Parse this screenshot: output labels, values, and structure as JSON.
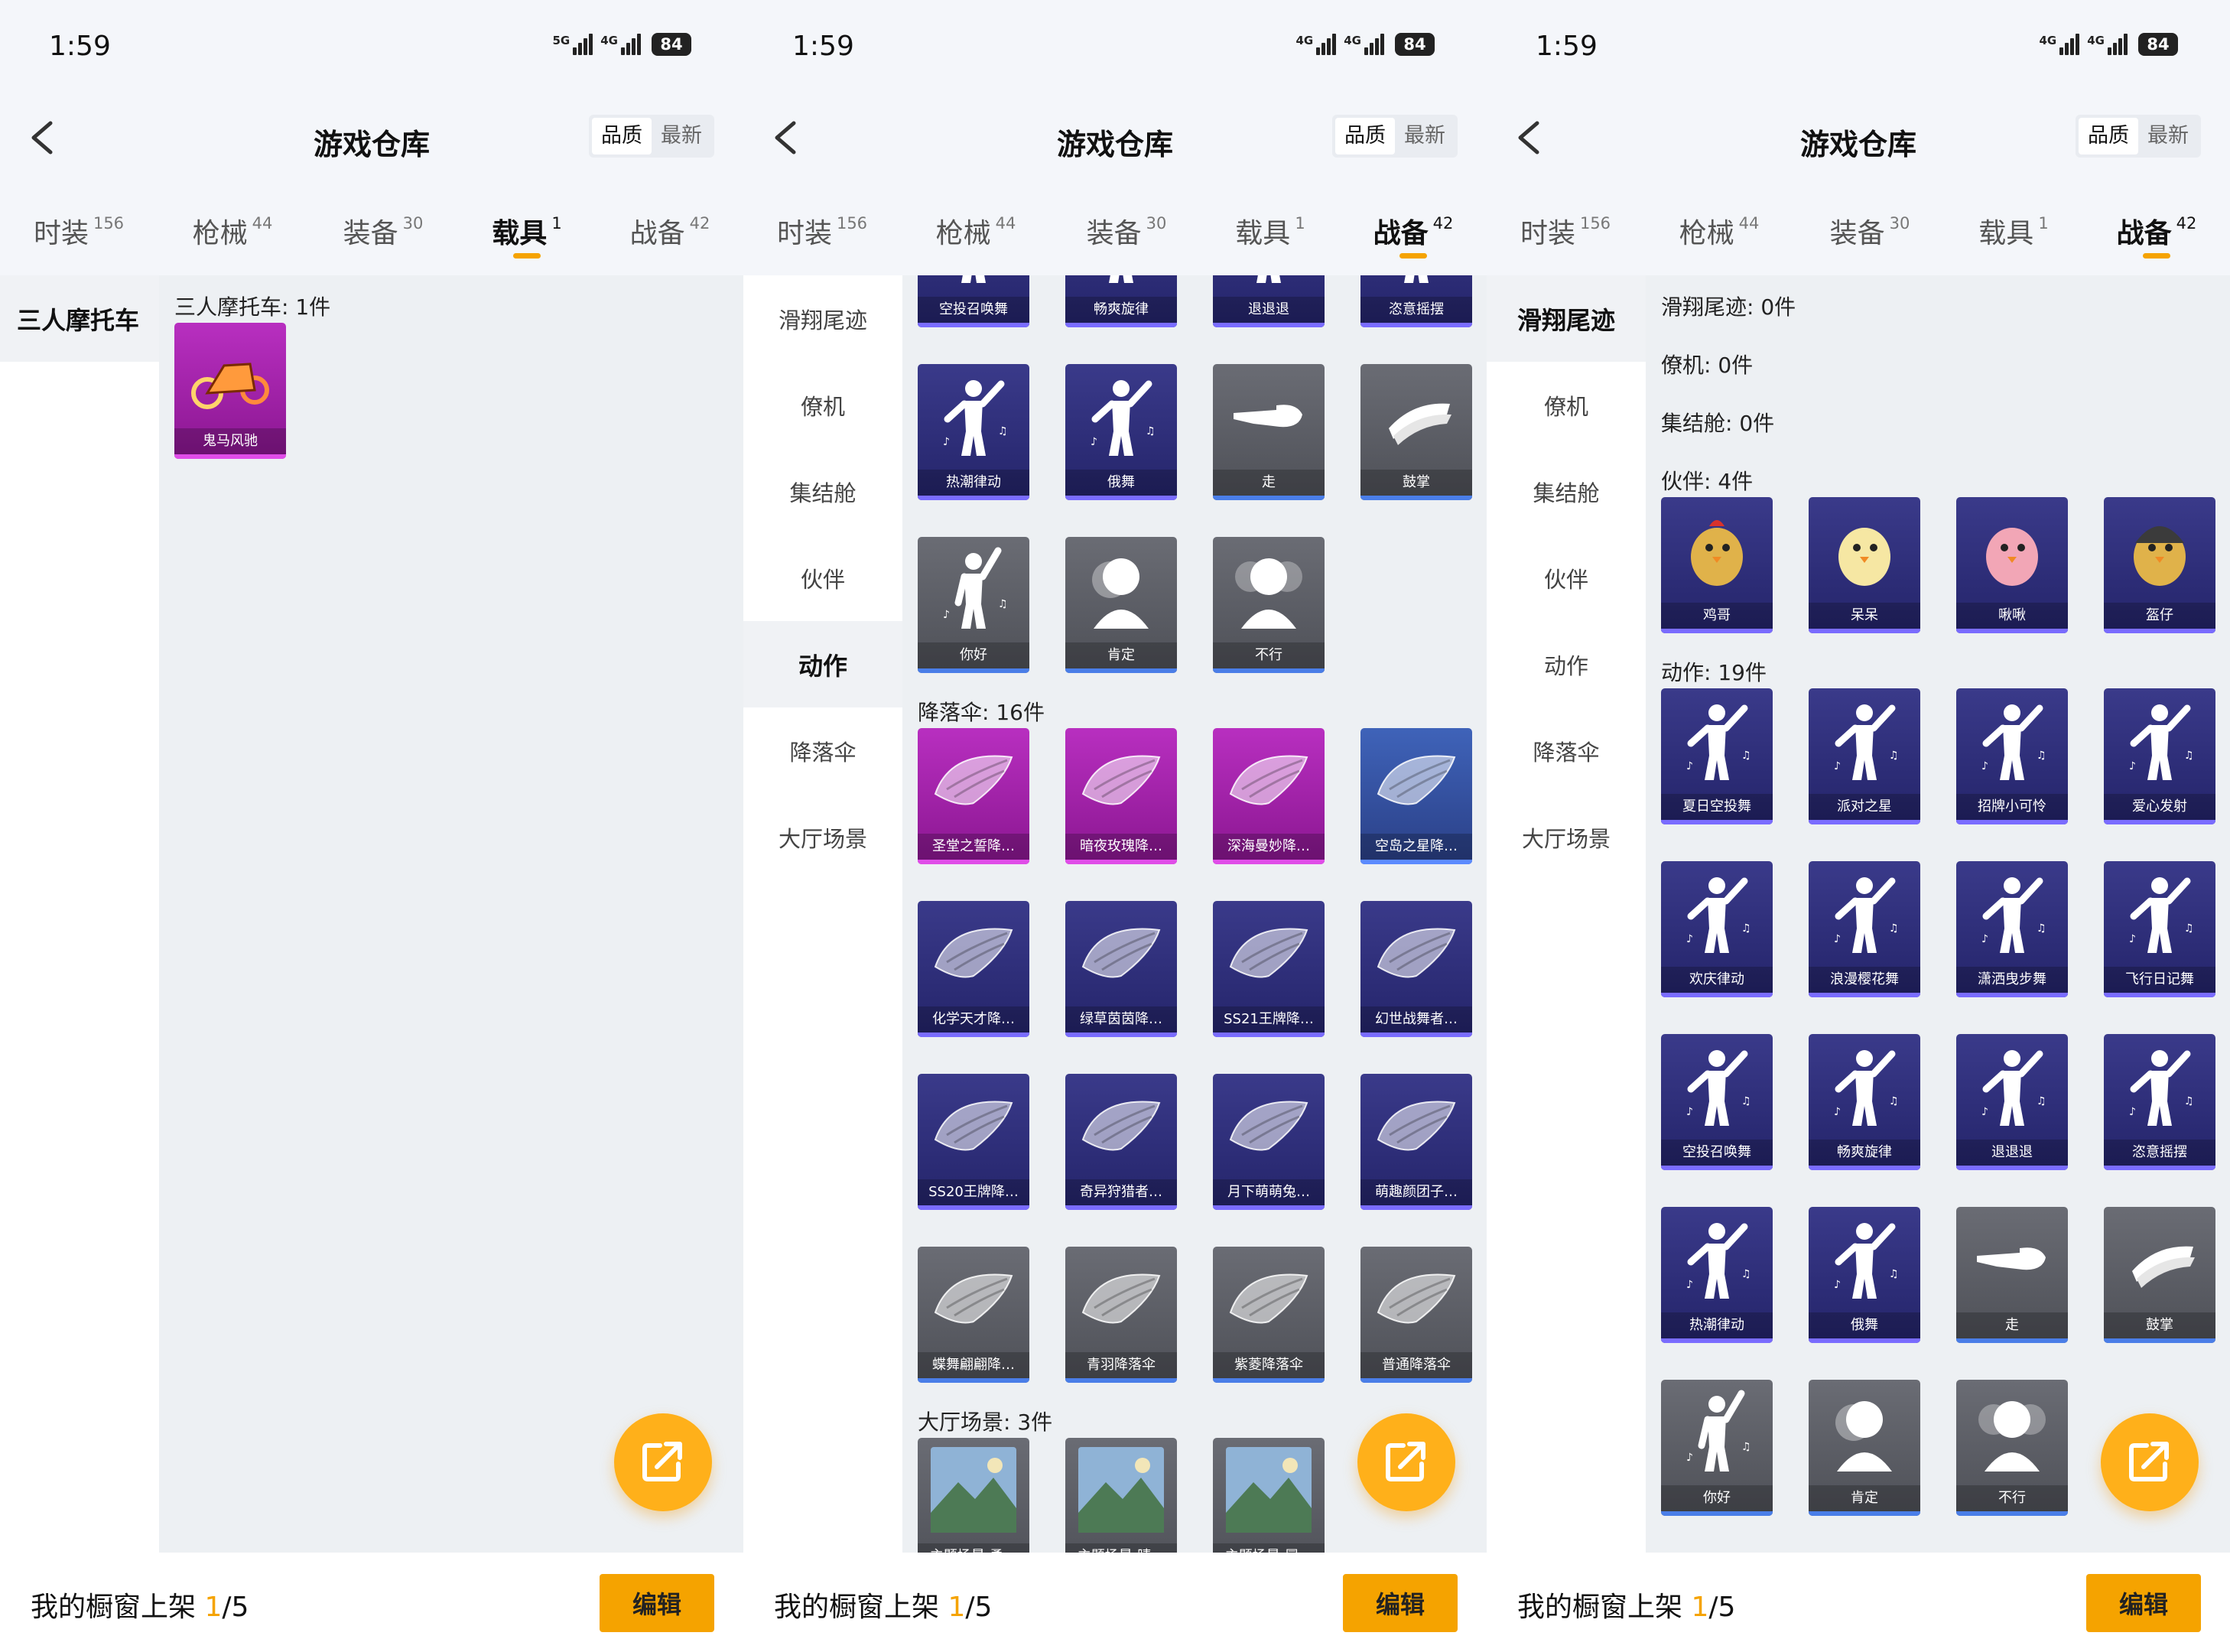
{
  "colors": {
    "accent": "#f5a300",
    "legend": "#b82fc0",
    "epic": "#3a3a8a",
    "common": "#5a5c63",
    "blue": "#3f63b9"
  },
  "panels": [
    {
      "status": {
        "time": "1:59",
        "signal_a": "5G",
        "signal_b": "4G",
        "battery": "84"
      },
      "header": {
        "title": "游戏仓库",
        "sort_quality": "品质",
        "sort_latest": "最新"
      },
      "tabs": [
        {
          "label": "时装",
          "count": "156",
          "active": false
        },
        {
          "label": "枪械",
          "count": "44",
          "active": false
        },
        {
          "label": "装备",
          "count": "30",
          "active": false
        },
        {
          "label": "载具",
          "count": "1",
          "active": true
        },
        {
          "label": "战备",
          "count": "42",
          "active": false
        }
      ],
      "categories": [
        {
          "label": "三人摩托车",
          "active": true
        }
      ],
      "sections": [
        {
          "title": "三人摩托车: 1件",
          "items": [
            {
              "name": "鬼马风驰",
              "quality": "legend",
              "icon": "tricycle-icon"
            }
          ]
        }
      ],
      "footer": {
        "label": "我的橱窗上架 ",
        "current": "1",
        "total": "/5",
        "edit": "编辑"
      }
    },
    {
      "status": {
        "time": "1:59",
        "signal_a": "4G",
        "signal_b": "4G",
        "battery": "84"
      },
      "header": {
        "title": "游戏仓库",
        "sort_quality": "品质",
        "sort_latest": "最新"
      },
      "tabs": [
        {
          "label": "时装",
          "count": "156",
          "active": false
        },
        {
          "label": "枪械",
          "count": "44",
          "active": false
        },
        {
          "label": "装备",
          "count": "30",
          "active": false
        },
        {
          "label": "载具",
          "count": "1",
          "active": false
        },
        {
          "label": "战备",
          "count": "42",
          "active": true
        }
      ],
      "categories": [
        {
          "label": "滑翔尾迹",
          "active": false
        },
        {
          "label": "僚机",
          "active": false
        },
        {
          "label": "集结舱",
          "active": false
        },
        {
          "label": "伙伴",
          "active": false
        },
        {
          "label": "动作",
          "active": true
        },
        {
          "label": "降落伞",
          "active": false
        },
        {
          "label": "大厅场景",
          "active": false
        }
      ],
      "sections": [
        {
          "title": "",
          "items": [
            {
              "name": "空投召唤舞",
              "quality": "epic",
              "icon": "dance-icon"
            },
            {
              "name": "畅爽旋律",
              "quality": "epic",
              "icon": "dance-icon"
            },
            {
              "name": "退退退",
              "quality": "epic",
              "icon": "dance-icon"
            },
            {
              "name": "恣意摇摆",
              "quality": "epic",
              "icon": "dance-icon"
            }
          ]
        },
        {
          "title": "",
          "items": [
            {
              "name": "热潮律动",
              "quality": "epic",
              "icon": "dance-icon"
            },
            {
              "name": "俄舞",
              "quality": "epic",
              "icon": "dance-icon"
            },
            {
              "name": "走",
              "quality": "common",
              "icon": "point-hand-icon"
            },
            {
              "name": "鼓掌",
              "quality": "common",
              "icon": "clap-icon"
            }
          ]
        },
        {
          "title": "",
          "items": [
            {
              "name": "你好",
              "quality": "common",
              "icon": "wave-icon"
            },
            {
              "name": "肯定",
              "quality": "common",
              "icon": "nod-icon"
            },
            {
              "name": "不行",
              "quality": "common",
              "icon": "shake-head-icon"
            }
          ]
        },
        {
          "title": "降落伞: 16件",
          "items": [
            {
              "name": "圣堂之誓降…",
              "quality": "legend",
              "icon": "parachute-icon"
            },
            {
              "name": "暗夜玫瑰降…",
              "quality": "legend",
              "icon": "parachute-icon"
            },
            {
              "name": "深海曼妙降…",
              "quality": "legend",
              "icon": "parachute-icon"
            },
            {
              "name": "空岛之星降…",
              "quality": "blue",
              "icon": "parachute-icon"
            }
          ]
        },
        {
          "title": "",
          "items": [
            {
              "name": "化学天才降…",
              "quality": "epic",
              "icon": "parachute-icon"
            },
            {
              "name": "绿草茵茵降…",
              "quality": "epic",
              "icon": "parachute-icon"
            },
            {
              "name": "SS21王牌降…",
              "quality": "epic",
              "icon": "parachute-icon"
            },
            {
              "name": "幻世战舞者…",
              "quality": "epic",
              "icon": "parachute-icon"
            }
          ]
        },
        {
          "title": "",
          "items": [
            {
              "name": "SS20王牌降…",
              "quality": "epic",
              "icon": "parachute-icon"
            },
            {
              "name": "奇异狩猎者…",
              "quality": "epic",
              "icon": "parachute-icon"
            },
            {
              "name": "月下萌萌兔…",
              "quality": "epic",
              "icon": "parachute-icon"
            },
            {
              "name": "萌趣颜团子…",
              "quality": "epic",
              "icon": "parachute-icon"
            }
          ]
        },
        {
          "title": "",
          "items": [
            {
              "name": "蝶舞翩翩降…",
              "quality": "common",
              "icon": "parachute-icon"
            },
            {
              "name": "青羽降落伞",
              "quality": "common",
              "icon": "parachute-icon"
            },
            {
              "name": "紫菱降落伞",
              "quality": "common",
              "icon": "parachute-icon"
            },
            {
              "name": "普通降落伞",
              "quality": "common",
              "icon": "parachute-icon"
            }
          ]
        },
        {
          "title": "大厅场景: 3件",
          "items": [
            {
              "name": "主题场景-勇…",
              "quality": "common",
              "icon": "landscape-icon"
            },
            {
              "name": "主题场景-晴…",
              "quality": "common",
              "icon": "landscape-icon"
            },
            {
              "name": "主题场景-冒…",
              "quality": "common",
              "icon": "landscape-icon"
            }
          ]
        }
      ],
      "footer": {
        "label": "我的橱窗上架 ",
        "current": "1",
        "total": "/5",
        "edit": "编辑"
      }
    },
    {
      "status": {
        "time": "1:59",
        "signal_a": "4G",
        "signal_b": "4G",
        "battery": "84"
      },
      "header": {
        "title": "游戏仓库",
        "sort_quality": "品质",
        "sort_latest": "最新"
      },
      "tabs": [
        {
          "label": "时装",
          "count": "156",
          "active": false
        },
        {
          "label": "枪械",
          "count": "44",
          "active": false
        },
        {
          "label": "装备",
          "count": "30",
          "active": false
        },
        {
          "label": "载具",
          "count": "1",
          "active": false
        },
        {
          "label": "战备",
          "count": "42",
          "active": true
        }
      ],
      "categories": [
        {
          "label": "滑翔尾迹",
          "active": true
        },
        {
          "label": "僚机",
          "active": false
        },
        {
          "label": "集结舱",
          "active": false
        },
        {
          "label": "伙伴",
          "active": false
        },
        {
          "label": "动作",
          "active": false
        },
        {
          "label": "降落伞",
          "active": false
        },
        {
          "label": "大厅场景",
          "active": false
        }
      ],
      "sections": [
        {
          "title": "滑翔尾迹: 0件",
          "items": []
        },
        {
          "title": "僚机: 0件",
          "items": []
        },
        {
          "title": "集结舱: 0件",
          "items": []
        },
        {
          "title": "伙伴: 4件",
          "items": [
            {
              "name": "鸡哥",
              "quality": "epic",
              "icon": "chicken-icon"
            },
            {
              "name": "呆呆",
              "quality": "epic",
              "icon": "chick-icon"
            },
            {
              "name": "啾啾",
              "quality": "epic",
              "icon": "pink-pet-icon"
            },
            {
              "name": "盔仔",
              "quality": "epic",
              "icon": "helmet-pet-icon"
            }
          ]
        },
        {
          "title": "动作: 19件",
          "items": [
            {
              "name": "夏日空投舞",
              "quality": "epic",
              "icon": "dance-icon"
            },
            {
              "name": "派对之星",
              "quality": "epic",
              "icon": "dance-icon"
            },
            {
              "name": "招牌小可怜",
              "quality": "epic",
              "icon": "dance-icon"
            },
            {
              "name": "爱心发射",
              "quality": "epic",
              "icon": "dance-icon"
            }
          ]
        },
        {
          "title": "",
          "items": [
            {
              "name": "欢庆律动",
              "quality": "epic",
              "icon": "dance-icon"
            },
            {
              "name": "浪漫樱花舞",
              "quality": "epic",
              "icon": "dance-icon"
            },
            {
              "name": "潇洒曳步舞",
              "quality": "epic",
              "icon": "dance-icon"
            },
            {
              "name": "飞行日记舞",
              "quality": "epic",
              "icon": "dance-icon"
            }
          ]
        },
        {
          "title": "",
          "items": [
            {
              "name": "空投召唤舞",
              "quality": "epic",
              "icon": "dance-icon"
            },
            {
              "name": "畅爽旋律",
              "quality": "epic",
              "icon": "dance-icon"
            },
            {
              "name": "退退退",
              "quality": "epic",
              "icon": "dance-icon"
            },
            {
              "name": "恣意摇摆",
              "quality": "epic",
              "icon": "dance-icon"
            }
          ]
        },
        {
          "title": "",
          "items": [
            {
              "name": "热潮律动",
              "quality": "epic",
              "icon": "dance-icon"
            },
            {
              "name": "俄舞",
              "quality": "epic",
              "icon": "dance-icon"
            },
            {
              "name": "走",
              "quality": "common",
              "icon": "point-hand-icon"
            },
            {
              "name": "鼓掌",
              "quality": "common",
              "icon": "clap-icon"
            }
          ]
        },
        {
          "title": "",
          "items": [
            {
              "name": "你好",
              "quality": "common",
              "icon": "wave-icon"
            },
            {
              "name": "肯定",
              "quality": "common",
              "icon": "nod-icon"
            },
            {
              "name": "不行",
              "quality": "common",
              "icon": "shake-head-icon"
            }
          ]
        }
      ],
      "footer": {
        "label": "我的橱窗上架 ",
        "current": "1",
        "total": "/5",
        "edit": "编辑"
      }
    }
  ]
}
